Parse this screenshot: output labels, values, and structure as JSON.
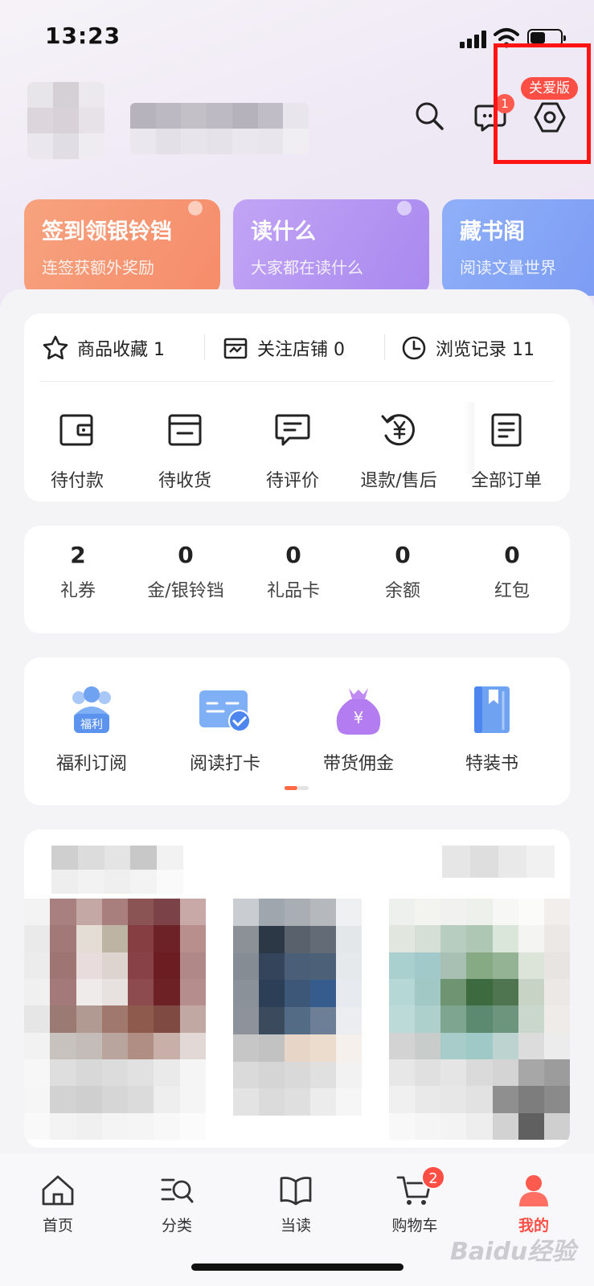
{
  "status_bar": {
    "time": "13:23"
  },
  "header": {
    "message_badge": "1",
    "care_badge": "关爱版"
  },
  "features": [
    {
      "title": "签到领银铃铛",
      "subtitle": "连签获额外奖励"
    },
    {
      "title": "读什么",
      "subtitle": "大家都在读什么"
    },
    {
      "title": "藏书阁",
      "subtitle": "阅读文量世界"
    }
  ],
  "quick_links": [
    {
      "label": "商品收藏 1",
      "icon": "star-icon"
    },
    {
      "label": "关注店铺 0",
      "icon": "store-icon"
    },
    {
      "label": "浏览记录 11",
      "icon": "clock-icon"
    }
  ],
  "orders": [
    {
      "label": "待付款",
      "icon": "wallet-icon"
    },
    {
      "label": "待收货",
      "icon": "package-icon"
    },
    {
      "label": "待评价",
      "icon": "comment-icon"
    },
    {
      "label": "退款/售后",
      "icon": "refund-icon"
    },
    {
      "label": "全部订单",
      "icon": "orders-icon"
    }
  ],
  "assets": [
    {
      "value": "2",
      "label": "礼券"
    },
    {
      "value": "0",
      "label": "金/银铃铛"
    },
    {
      "value": "0",
      "label": "礼品卡"
    },
    {
      "value": "0",
      "label": "余额"
    },
    {
      "value": "0",
      "label": "红包"
    }
  ],
  "services": [
    {
      "label": "福利订阅",
      "icon": "welfare-icon",
      "icon_text": "福利"
    },
    {
      "label": "阅读打卡",
      "icon": "reading-checkin-icon"
    },
    {
      "label": "带货佣金",
      "icon": "money-bag-icon",
      "icon_text": "¥"
    },
    {
      "label": "特装书",
      "icon": "special-book-icon"
    }
  ],
  "bottom_nav": [
    {
      "label": "首页",
      "icon": "home-icon"
    },
    {
      "label": "分类",
      "icon": "category-icon"
    },
    {
      "label": "当读",
      "icon": "book-icon"
    },
    {
      "label": "购物车",
      "icon": "cart-icon",
      "badge": "2"
    },
    {
      "label": "我的",
      "icon": "profile-icon",
      "active": true
    }
  ],
  "colors": {
    "accent": "#ff4f45",
    "highlight_box": "#ff1414"
  },
  "watermark": "Baidu经验"
}
